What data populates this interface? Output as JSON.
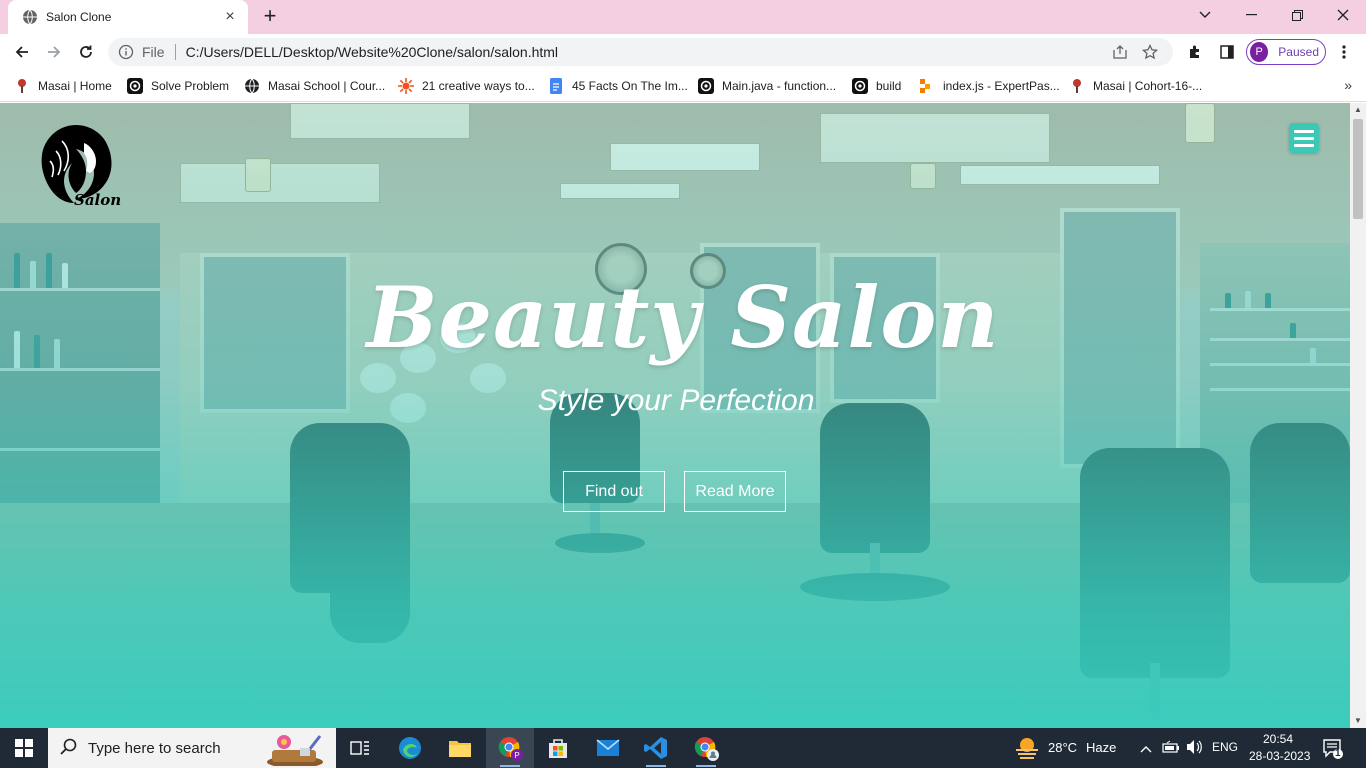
{
  "browser": {
    "tab": {
      "title": "Salon Clone",
      "favicon": "globe-icon"
    },
    "address": {
      "scheme_label": "File",
      "url": "C:/Users/DELL/Desktop/Website%20Clone/salon/salon.html"
    },
    "profile": {
      "initial": "P",
      "status": "Paused"
    },
    "bookmarks": [
      {
        "label": "Masai | Home",
        "icon": "masai-icon"
      },
      {
        "label": "Solve Problem",
        "icon": "spiral-icon"
      },
      {
        "label": "Masai School | Cour...",
        "icon": "globe-icon"
      },
      {
        "label": "21 creative ways to...",
        "icon": "sun-icon"
      },
      {
        "label": "45 Facts On The Im...",
        "icon": "doc-icon"
      },
      {
        "label": "Main.java - function...",
        "icon": "spiral-icon"
      },
      {
        "label": "build",
        "icon": "spiral-icon"
      },
      {
        "label": "index.js - ExpertPas...",
        "icon": "expertpass-icon"
      },
      {
        "label": "Masai | Cohort-16-...",
        "icon": "masai-icon"
      }
    ]
  },
  "page": {
    "logo_text": "Salon",
    "hero_title": "Beauty Salon",
    "hero_subtitle": "Style your Perfection",
    "buttons": {
      "find_out": "Find out",
      "read_more": "Read More"
    },
    "accent_color": "#3cc8b4"
  },
  "taskbar": {
    "search_placeholder": "Type here to search",
    "weather": {
      "temp": "28°C",
      "condition": "Haze"
    },
    "language": "ENG",
    "time": "20:54",
    "date": "28-03-2023",
    "notifications": "1"
  }
}
